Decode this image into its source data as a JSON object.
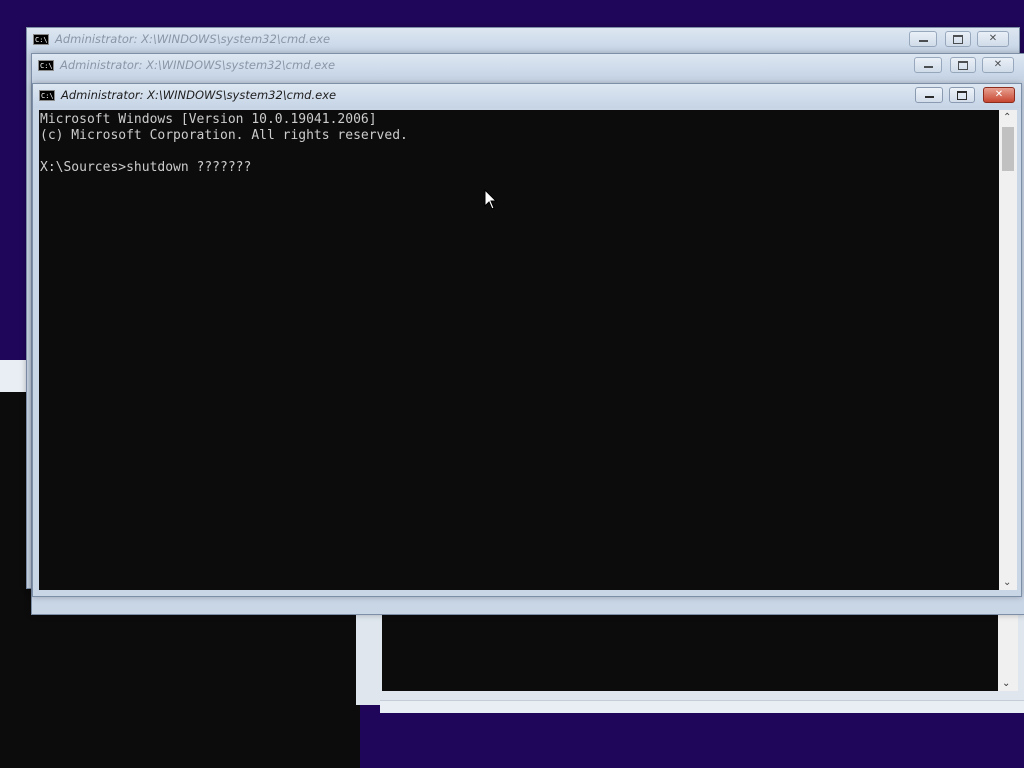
{
  "colors": {
    "desktop": "#20065a",
    "console_bg": "#0c0c0c",
    "console_text": "#cccccc",
    "titlebar": "#c9d6e6",
    "close_button": "#c74630"
  },
  "windows": [
    {
      "title": "Administrator: X:\\WINDOWS\\system32\\cmd.exe",
      "state": "inactive"
    },
    {
      "title": "Administrator: X:\\WINDOWS\\system32\\cmd.exe",
      "state": "inactive"
    },
    {
      "title": "Administrator: X:\\WINDOWS\\system32\\cmd.exe",
      "state": "active"
    }
  ],
  "console": {
    "lines": [
      "Microsoft Windows [Version 10.0.19041.2006]",
      "(c) Microsoft Corporation. All rights reserved.",
      "",
      "X:\\Sources>shutdown ???????"
    ]
  },
  "icons": {
    "window_icon": "cmd-icon",
    "minimize": "minimize-icon",
    "maximize": "maximize-icon",
    "close": "close-icon",
    "scroll_up": "chevron-up-icon",
    "scroll_down": "chevron-down-icon",
    "pointer": "mouse-pointer-icon"
  },
  "glyphs": {
    "cmd_icon": "C:\\",
    "close": "✕",
    "up": "⌃",
    "down": "⌄"
  }
}
